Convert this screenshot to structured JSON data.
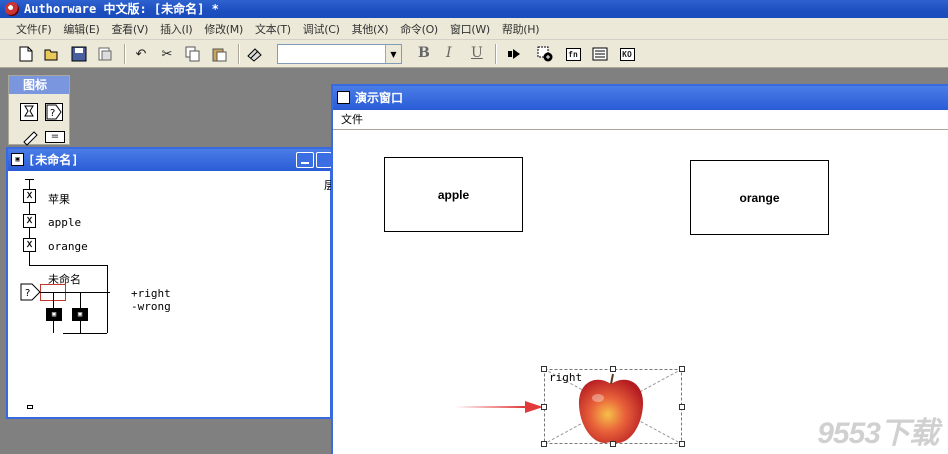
{
  "app": {
    "title": "Authorware 中文版: [未命名] *"
  },
  "menubar": {
    "items": [
      "文件(F)",
      "编辑(E)",
      "查看(V)",
      "插入(I)",
      "修改(M)",
      "文本(T)",
      "调试(C)",
      "其他(X)",
      "命令(O)",
      "窗口(W)",
      "帮助(H)"
    ]
  },
  "toolbar": {
    "font_combo_value": "",
    "bold": "B",
    "italic": "I",
    "underline": "U",
    "fn_label": "fn",
    "ko_label": "KO"
  },
  "palette": {
    "title": "图标"
  },
  "flow_window": {
    "title": "[未命名]",
    "edge_label": "层",
    "icons": [
      {
        "label": "苹果"
      },
      {
        "label": "apple"
      },
      {
        "label": "orange"
      }
    ],
    "interaction": {
      "label": "未命名",
      "responses": [
        "+right",
        "-wrong"
      ]
    }
  },
  "presentation_window": {
    "title": "演示窗口",
    "menu_file": "文件",
    "boxes": [
      "apple",
      "orange"
    ],
    "target_label": "right"
  },
  "watermark": "9553下载"
}
